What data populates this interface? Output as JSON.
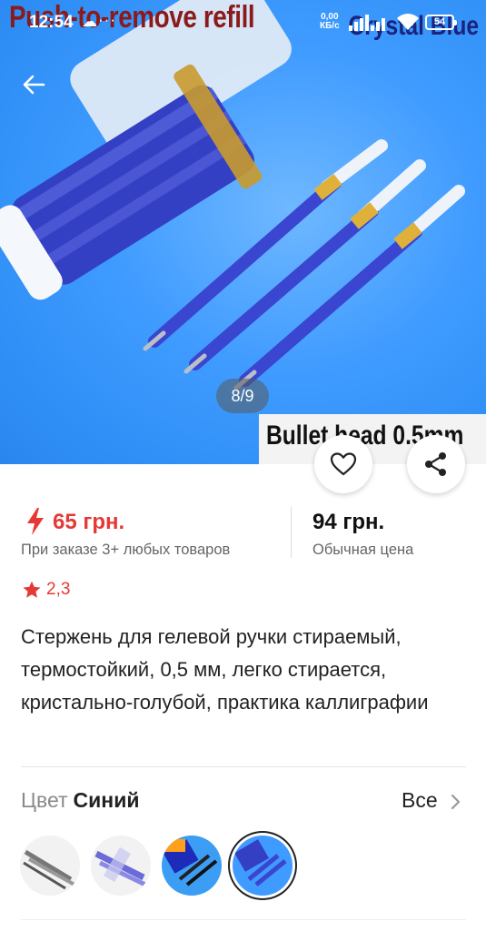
{
  "status_bar": {
    "time": "12:54",
    "speed_value": "0,00",
    "speed_unit": "КБ/с",
    "battery": "54"
  },
  "gallery": {
    "caption_top": "Push-to-remove refill",
    "caption_right": "Crystal Blue",
    "caption_bottom": "Bullet head 0.5mm",
    "counter": "8/9"
  },
  "price": {
    "sale": "65 грн.",
    "sale_note": "При заказе 3+ любых товаров",
    "regular": "94 грн.",
    "regular_note": "Обычная цена",
    "sale_color": "#e53935"
  },
  "rating": {
    "value": "2,3"
  },
  "product": {
    "title": "Стержень для гелевой ручки стираемый, термостойкий, 0,5 мм, легко стирается, кристально-голубой, практика каллиграфии"
  },
  "color_section": {
    "label": "Цвет",
    "selected": "Синий",
    "all_label": "Все",
    "swatch_count": 4,
    "selected_index": 3
  },
  "icons": {
    "back": "arrow-left-icon",
    "favorite": "heart-icon",
    "share": "share-icon",
    "sale": "bolt-icon",
    "rating": "star-icon",
    "more": "chevron-right-icon"
  }
}
